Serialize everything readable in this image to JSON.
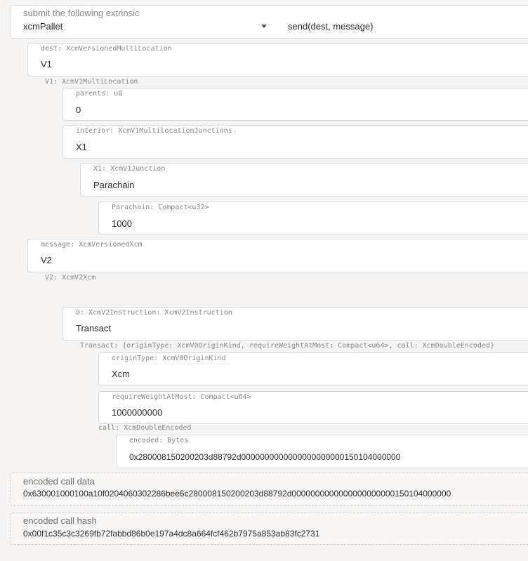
{
  "extrinsic": {
    "label": "submit the following extrinsic",
    "pallet": "xcmPallet",
    "call": "send(dest, message)"
  },
  "dest": {
    "label": "dest: XcmVersionedMultiLocation",
    "value": "V1",
    "v1_label": "V1: XcmV1MultiLocation",
    "parents": {
      "label": "parents: u8",
      "value": "0"
    },
    "interior": {
      "label": "interior: XcmV1MultilocationJunctions",
      "value": "X1",
      "x1": {
        "label": "X1: XcmV1Junction",
        "value": "Parachain",
        "parachain": {
          "label": "Parachain: Compact<u32>",
          "value": "1000"
        }
      }
    }
  },
  "message": {
    "label": "message: XcmVersionedXcm",
    "value": "V2",
    "v2_label": "V2: XcmV2Xcm",
    "instruction": {
      "label": "0: XcmV2Instruction: XcmV2Instruction",
      "value": "Transact",
      "transact_label": "Transact: {originType: XcmV0OriginKind, requireWeightAtMost: Compact<u64>, call: XcmDoubleEncoded}",
      "origin_type": {
        "label": "originType: XcmV0OriginKind",
        "value": "Xcm"
      },
      "weight": {
        "label": "requireWeightAtMost: Compact<u64>",
        "value": "1000000000"
      },
      "call_label": "call: XcmDoubleEncoded",
      "encoded": {
        "label": "encoded: Bytes",
        "value": "0x280008150200203d88792d0000000000000000000000150104000000"
      }
    }
  },
  "encoded_call_data": {
    "label": "encoded call data",
    "value": "0x630001000100a10f0204060302286bee6c280008150200203d88792d0000000000000000000000150104000000"
  },
  "encoded_call_hash": {
    "label": "encoded call hash",
    "value": "0x00f1c35c3c3269fb72fabbd86b0e197a4dc8a664fcf462b7975a853ab83fc2731"
  }
}
